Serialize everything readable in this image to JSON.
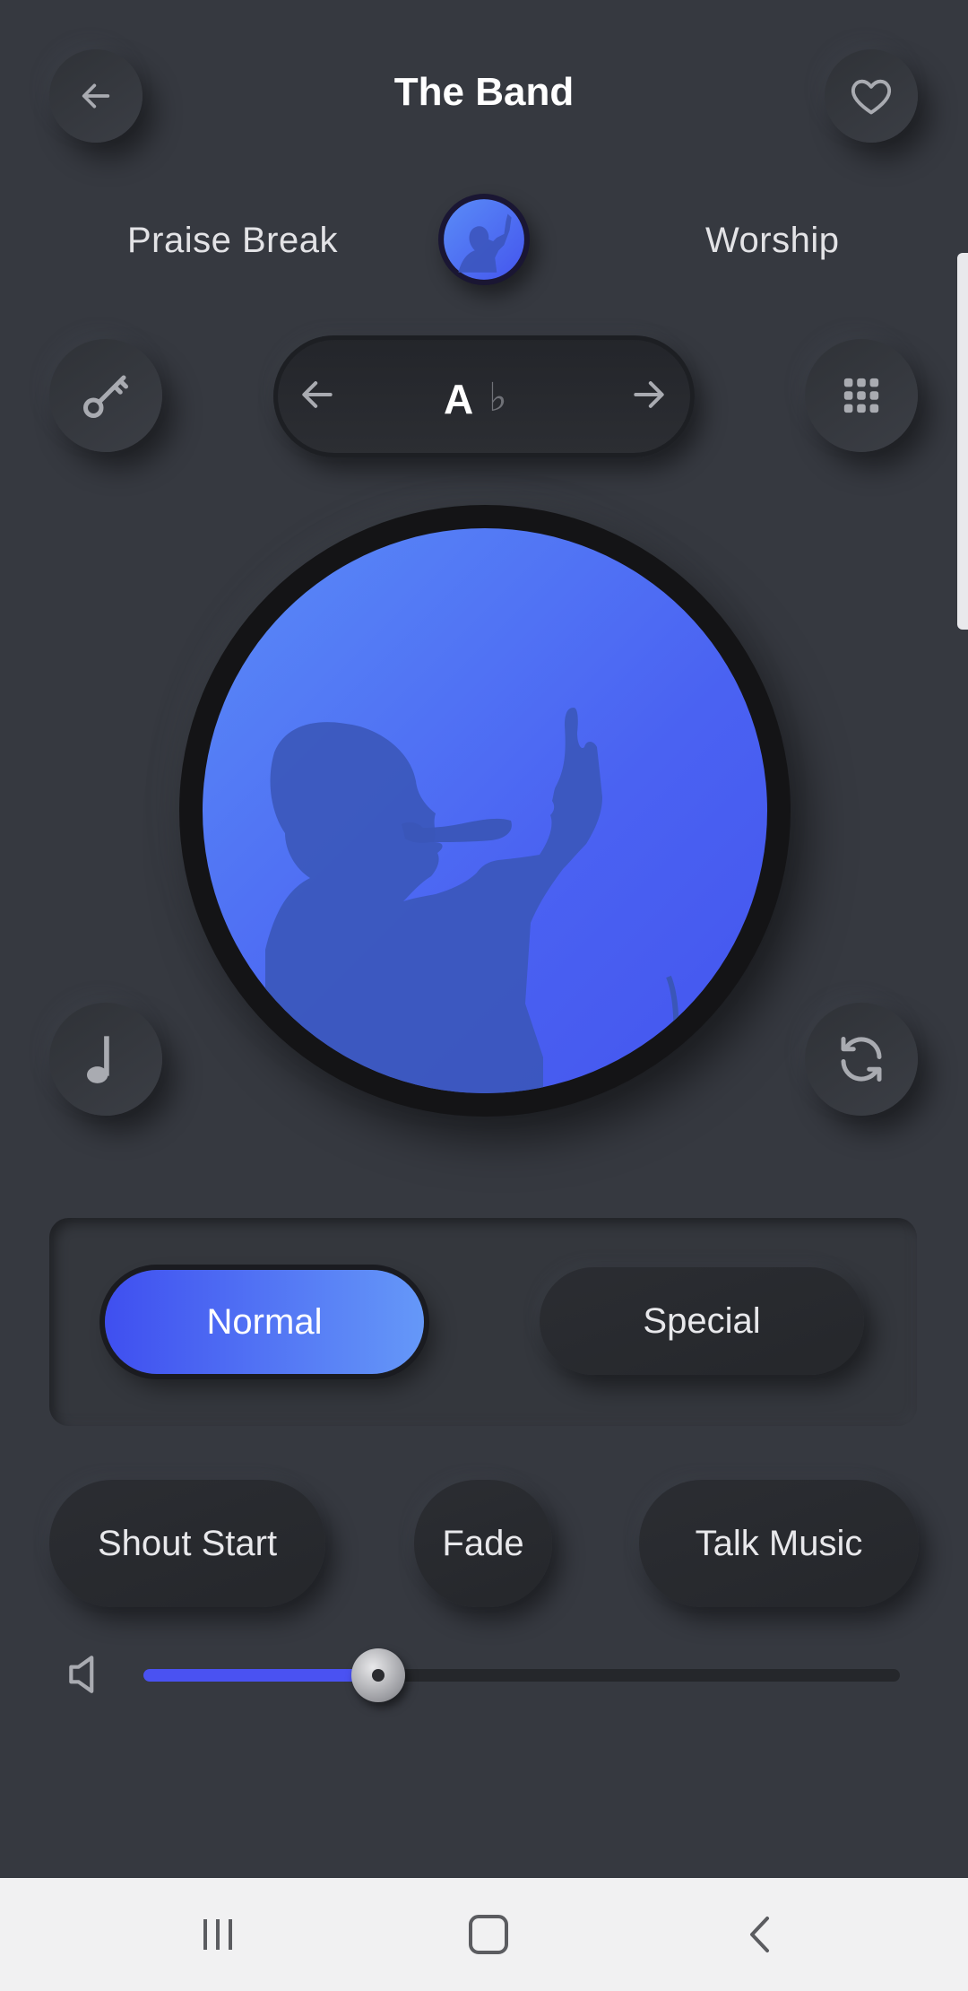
{
  "header": {
    "title": "The Band",
    "back_icon": "arrow-left-icon",
    "favorite_icon": "heart-icon"
  },
  "style_selector": {
    "left_label": "Praise Break",
    "right_label": "Worship"
  },
  "key_selector": {
    "letter": "A",
    "accidental": "♭",
    "prev_icon": "arrow-left-icon",
    "next_icon": "arrow-right-icon"
  },
  "side_controls": {
    "key_icon": "key-icon",
    "grid_icon": "grid-icon",
    "note_icon": "music-note-icon",
    "repeat_icon": "repeat-icon"
  },
  "mode": {
    "options": [
      "Normal",
      "Special"
    ],
    "selected": "Normal"
  },
  "actions": [
    "Shout Start",
    "Fade",
    "Talk Music"
  ],
  "volume": {
    "icon": "speaker-icon",
    "level": 0.31
  },
  "colors": {
    "background": "#363940",
    "accent_start": "#3f4ff0",
    "accent_end": "#6598f8"
  },
  "system_nav": {
    "recents_icon": "recents-icon",
    "home_icon": "home-icon",
    "back_icon": "back-chevron-icon"
  }
}
